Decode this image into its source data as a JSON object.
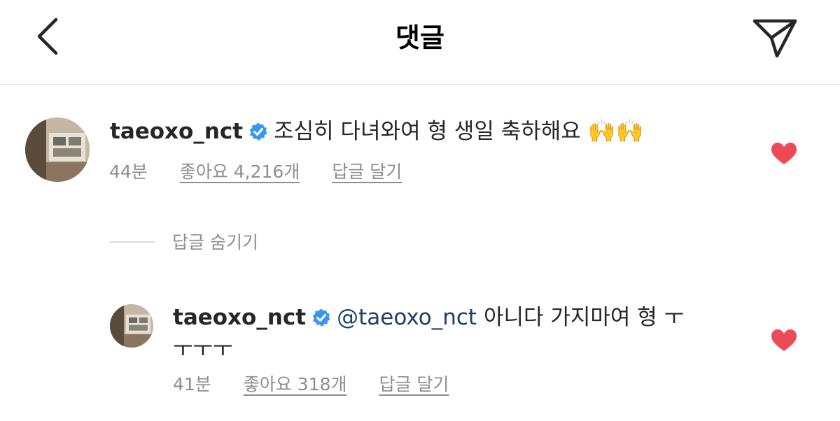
{
  "header": {
    "title": "댓글",
    "back_icon": "chevron-left-icon",
    "send_icon": "paper-plane-icon"
  },
  "comment": {
    "username": "taeoxo_nct",
    "verified_icon": "verified-badge-icon",
    "text": "조심히 다녀와여 형 생일 축하해요",
    "emoji": "🙌🙌",
    "time": "44분",
    "likes": "좋아요 4,216개",
    "reply_label": "답글 달기",
    "liked": true
  },
  "replies_toggle": "답글 숨기기",
  "reply": {
    "username": "taeoxo_nct",
    "verified_icon": "verified-badge-icon",
    "mention": "@taeoxo_nct",
    "text_line1": "아니다 가지마여 형 ㅜ",
    "text_line2": "ㅜㅜㅜ",
    "time": "41분",
    "likes": "좋아요 318개",
    "reply_label": "답글 달기",
    "liked": true
  },
  "colors": {
    "heart": "#ed4956",
    "verified": "#3897f0",
    "mention": "#1e3f66",
    "meta_text": "#8e8e8e",
    "divider": "#dbdbdb"
  }
}
